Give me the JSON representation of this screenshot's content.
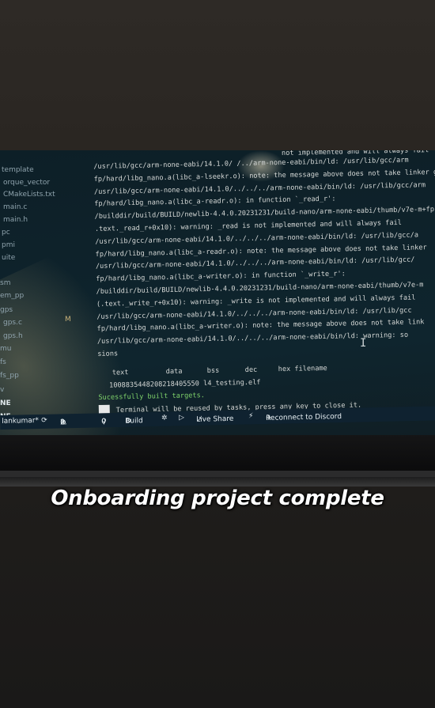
{
  "explorer": {
    "items": [
      "template",
      "orque_vector",
      "CMakeLists.txt",
      "main.c",
      "main.h",
      "pc",
      "pmi",
      "uite",
      "sm",
      "em_pp",
      "gps",
      "gps.c",
      "gps.h",
      "mu",
      "fs",
      "fs_pp",
      "v",
      "NE",
      "NE"
    ],
    "badge": "M"
  },
  "terminal": {
    "lines": [
      "/usr/lib/gcc/arm-none-eabi/14.1.0/    /../arm-none-eabi/bin/ld: /usr/lib/gcc/arm",
      "fp/hard/libg_nano.a(libc_a-lseekr.o): note: the message above does not take linker g",
      "/usr/lib/gcc/arm-none-eabi/14.1.0/../../../arm-none-eabi/bin/ld: /usr/lib/gcc/arm",
      "fp/hard/libg_nano.a(libc_a-readr.o): in function `_read_r':",
      "/builddir/build/BUILD/newlib-4.4.0.20231231/build-nano/arm-none-eabi/thumb/v7e-m+fp",
      ".text._read_r+0x10): warning: _read is not implemented and will always fail",
      "/usr/lib/gcc/arm-none-eabi/14.1.0/../../../arm-none-eabi/bin/ld: /usr/lib/gcc/a",
      "fp/hard/libg_nano.a(libc_a-readr.o): note: the message above does not take linker",
      "/usr/lib/gcc/arm-none-eabi/14.1.0/../../../arm-none-eabi/bin/ld: /usr/lib/gcc/",
      "fp/hard/libg_nano.a(libc_a-writer.o): in function `_write_r':",
      "/builddir/build/BUILD/newlib-4.4.0.20231231/build-nano/arm-none-eabi/thumb/v7e-m",
      "(.text._write_r+0x10): warning: _write is not implemented and will always fail",
      "/usr/lib/gcc/arm-none-eabi/14.1.0/../../../arm-none-eabi/bin/ld: /usr/lib/gcc",
      "fp/hard/libg_nano.a(libc_a-writer.o): note: the message above does not take link",
      "/usr/lib/gcc/arm-none-eabi/14.1.0/../../../arm-none-eabi/bin/ld: warning: so",
      "sions"
    ],
    "top_fragment": "not implemented and will always fail",
    "size_header": [
      "text",
      "data",
      "bss",
      "dec",
      "hex filename"
    ],
    "size_values": [
      "10088",
      "3544",
      "8208",
      "21840",
      "5550 l4_testing.elf"
    ],
    "success": "Sucessfully built targets.",
    "reuse": "Terminal will be reused by tasks, press any key to close it."
  },
  "statusbar": {
    "user": "lankumar*",
    "errors": "2",
    "warnings": "0",
    "ports": "0",
    "build": "Build",
    "live_share": "Live Share",
    "discord": "Reconnect to Discord"
  },
  "caption": "Onboarding project complete",
  "colors": {
    "terminal_bg": "#0f252e",
    "success_green": "#7fd36b",
    "statusbar_bg": "#0f2230",
    "caption": "#ffffff"
  }
}
